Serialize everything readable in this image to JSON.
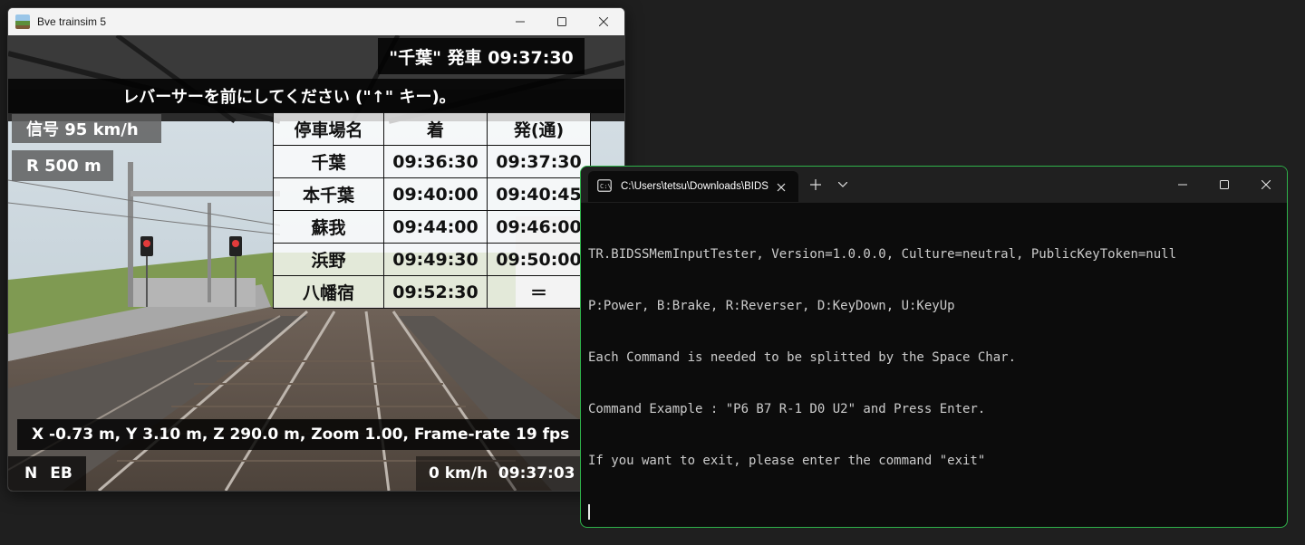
{
  "bve": {
    "title": "Bve trainsim 5",
    "departure": "\"千葉\" 発車 09:37:30",
    "message": "レバーサーを前にしてください (\"↑\" キー)。",
    "signal": "信号 95 km/h",
    "curve": "R 500 m",
    "timetable": {
      "headers": [
        "停車場名",
        "着",
        "発(通)"
      ],
      "rows": [
        [
          "千葉",
          "09:36:30",
          "09:37:30"
        ],
        [
          "本千葉",
          "09:40:00",
          "09:40:45"
        ],
        [
          "蘇我",
          "09:44:00",
          "09:46:00"
        ],
        [
          "浜野",
          "09:49:30",
          "09:50:00"
        ],
        [
          "八幡宿",
          "09:52:30",
          "＝"
        ]
      ]
    },
    "camera_info": "X -0.73 m, Y 3.10 m, Z 290.0 m, Zoom 1.00, Frame-rate 19 fps",
    "reverser": "N",
    "brake": "EB",
    "speed_time": "0 km/h  09:37:03"
  },
  "terminal": {
    "tab_title": "C:\\Users\\tetsu\\Downloads\\BIDS",
    "lines": [
      "TR.BIDSSMemInputTester, Version=1.0.0.0, Culture=neutral, PublicKeyToken=null",
      "P:Power, B:Brake, R:Reverser, D:KeyDown, U:KeyUp",
      "Each Command is needed to be splitted by the Space Char.",
      "Command Example : \"P6 B7 R-1 D0 U2\" and Press Enter.",
      "If you want to exit, please enter the command \"exit\""
    ]
  },
  "icons": {
    "minimize": "minimize-icon",
    "maximize": "maximize-icon",
    "close": "close-icon",
    "terminal_tab": "terminal-icon",
    "new_tab": "plus-icon",
    "dropdown": "chevron-down-icon"
  }
}
